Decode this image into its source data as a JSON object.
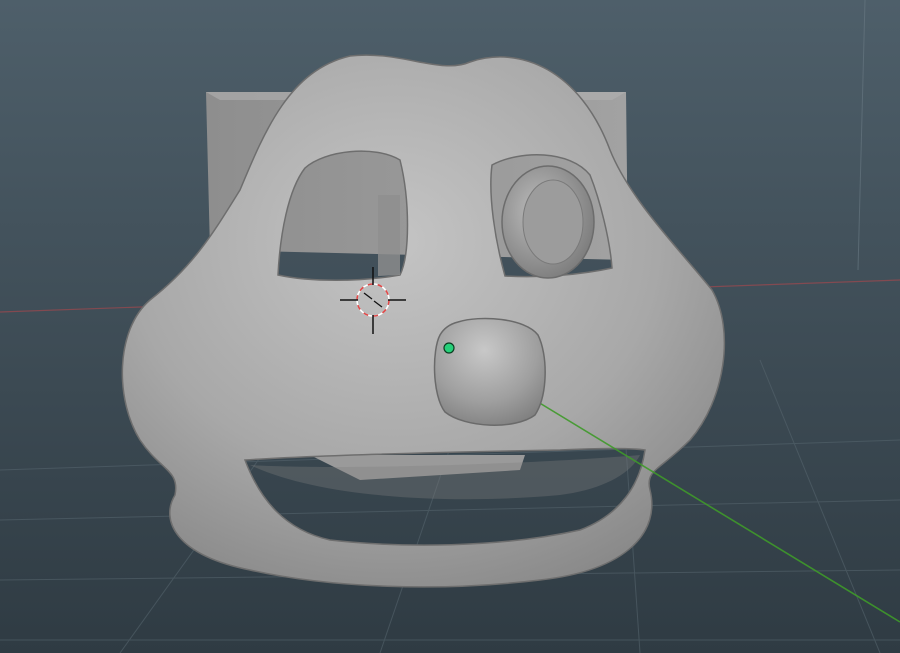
{
  "viewport": {
    "background_top": "#4e5f6a",
    "background_bottom": "#2f3b43",
    "grid_color": "#55646d",
    "x_axis_color": "#a0484e",
    "y_axis_color": "#3f9a2a"
  },
  "scene": {
    "mesh_color": "#a6a6a6",
    "mesh_shadow_color": "#6e6e6e",
    "selection_dot_color": "#27d07a"
  },
  "cursor": {
    "icon": "3d-cursor-icon",
    "ring_color_a": "#e04848",
    "ring_color_b": "#ffffff"
  }
}
